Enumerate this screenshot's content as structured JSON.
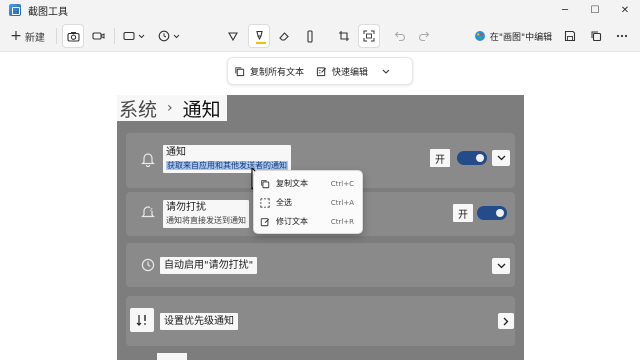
{
  "app": {
    "title": "截图工具"
  },
  "window": {
    "minimize_glyph": "─",
    "maximize_glyph": "☐",
    "close_glyph": "✕"
  },
  "toolbar": {
    "new_label": "新建",
    "new_glyph": "+",
    "edit_in_paint_label": "在\"画图\"中编辑",
    "highlighter_color": "#f2c400"
  },
  "action_bar": {
    "copy_all_text": "复制所有文本",
    "quick_redact": "快速编辑"
  },
  "settings": {
    "breadcrumb_parent": "系统",
    "breadcrumb_sep": "›",
    "breadcrumb_current": "通知",
    "notifications": {
      "title": "通知",
      "subtitle": "获取来自应用和其他发送者的通知",
      "toggle_state": "开"
    },
    "dnd": {
      "title": "请勿打扰",
      "subtitle": "通知将直接发送到通知",
      "toggle_state": "开"
    },
    "auto_dnd": {
      "title": "自动启用\"请勿打扰\""
    },
    "priority": {
      "title": "设置优先级通知"
    },
    "toggle_color": "#244b8a"
  },
  "context_menu": {
    "items": [
      {
        "label": "复制文本",
        "shortcut": "Ctrl+C",
        "icon": "copy-icon"
      },
      {
        "label": "全选",
        "shortcut": "Ctrl+A",
        "icon": "select-all-icon"
      },
      {
        "label": "修订文本",
        "shortcut": "Ctrl+R",
        "icon": "redact-icon"
      }
    ]
  }
}
